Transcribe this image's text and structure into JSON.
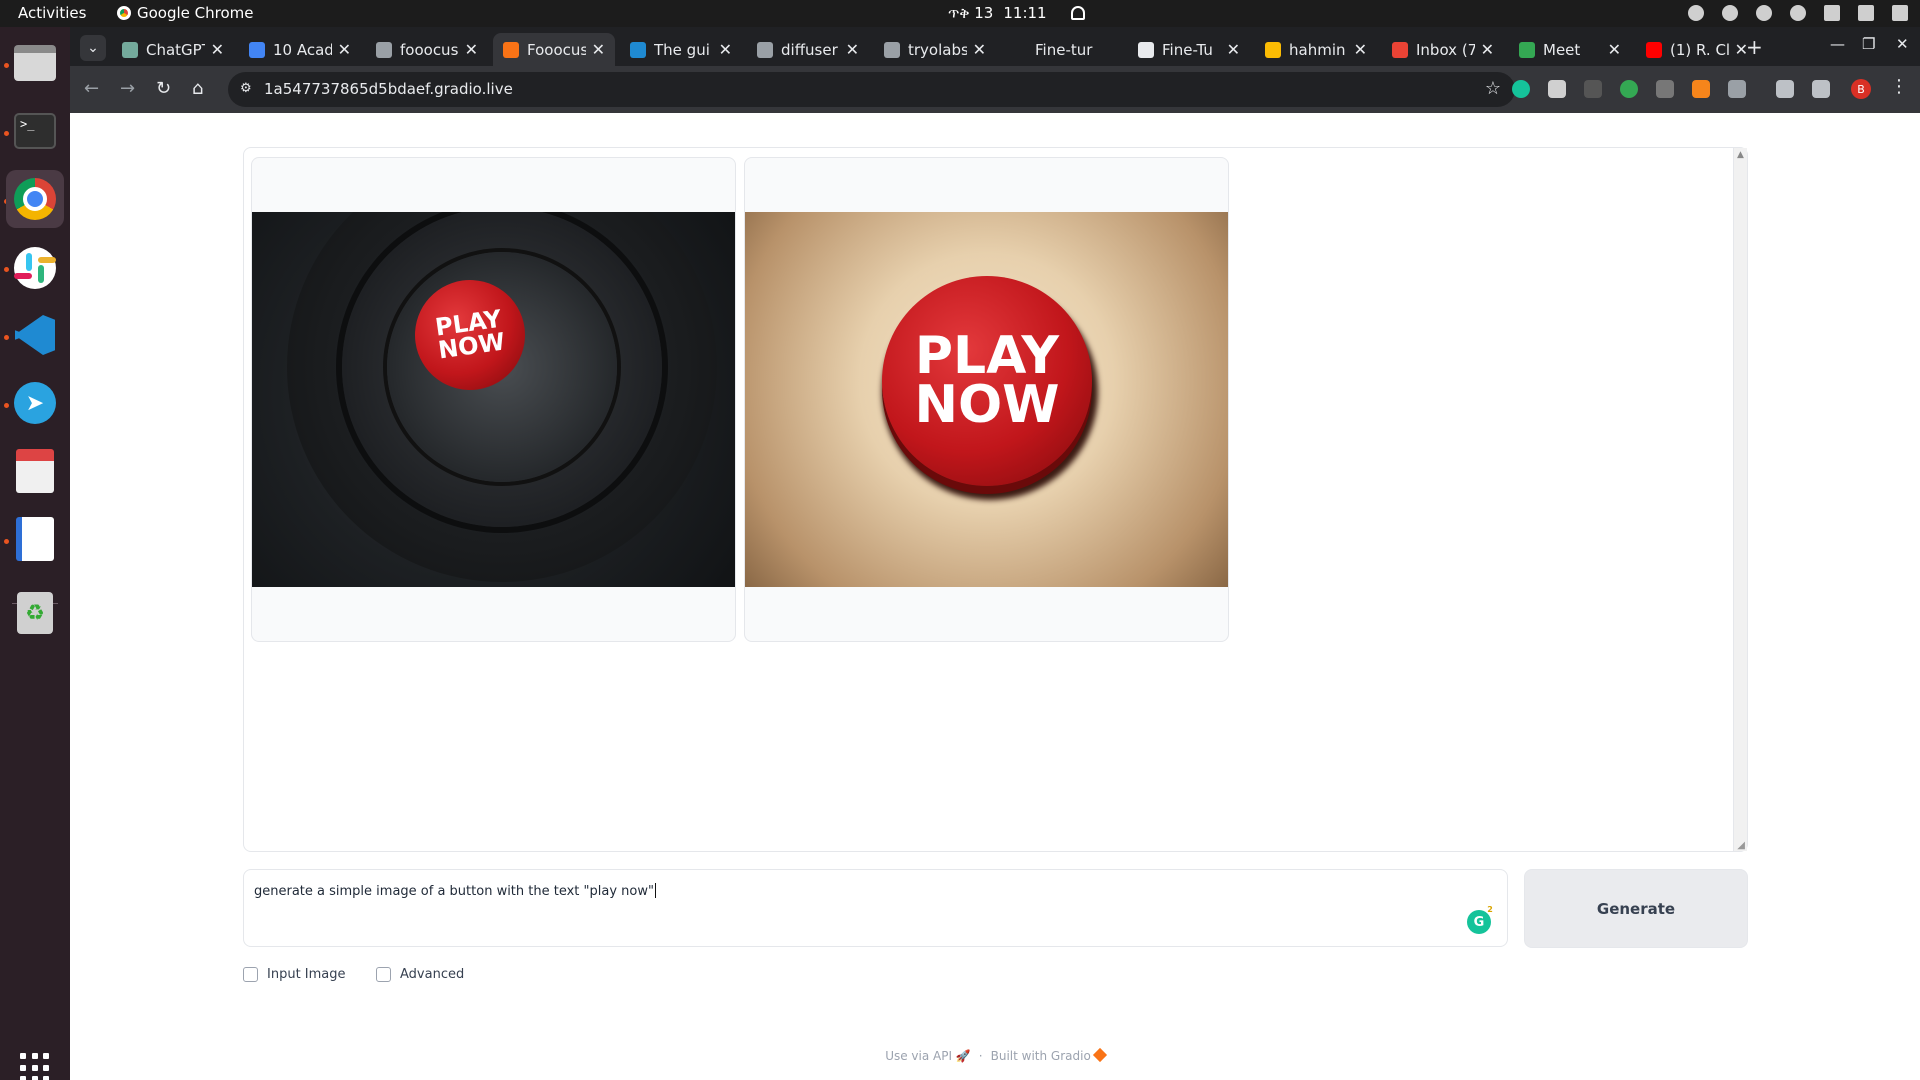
{
  "topbar": {
    "activities": "Activities",
    "app_name": "Google Chrome",
    "date": "ጥቅ 13",
    "time": "11:11"
  },
  "browser": {
    "tabs": [
      {
        "label": "ChatGPT",
        "color": "#74aa9c"
      },
      {
        "label": "10 Acad",
        "color": "#4285f4"
      },
      {
        "label": "fooocus",
        "color": "#9aa0a6"
      },
      {
        "label": "Fooocus",
        "color": "#f97316"
      },
      {
        "label": "The gui",
        "color": "#1f8ad2"
      },
      {
        "label": "diffuser",
        "color": "#9aa0a6"
      },
      {
        "label": "tryolabs",
        "color": "#9aa0a6"
      },
      {
        "label": "Fine-tur",
        "color": "#202124"
      },
      {
        "label": "Fine-Tu",
        "color": "#e8eaed"
      },
      {
        "label": "hahmin",
        "color": "#fbbc04"
      },
      {
        "label": "Inbox (7",
        "color": "#ea4335"
      },
      {
        "label": "Meet",
        "color": "#34a853"
      },
      {
        "label": "(1) R. Cl",
        "color": "#ff0000"
      }
    ],
    "url": "1a547737865d5bdaef.gradio.live"
  },
  "images": [
    {
      "name": "generated-image-1",
      "text_line1": "PLAY",
      "text_line2": "NOW"
    },
    {
      "name": "generated-image-2",
      "text_line1": "PLAY",
      "text_line2": "NOW"
    }
  ],
  "prompt": {
    "value": "generate a simple image of a button with the text \"play now\""
  },
  "grammarly_badge": "2",
  "generate_label": "Generate",
  "options": {
    "input_image": "Input Image",
    "advanced": "Advanced"
  },
  "footer": {
    "api": "Use via API",
    "sep": "·",
    "built": "Built with Gradio"
  }
}
